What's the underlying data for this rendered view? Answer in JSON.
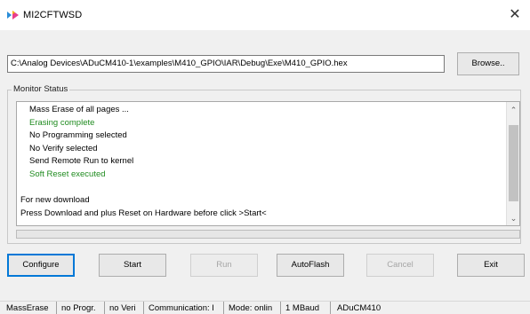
{
  "window": {
    "title": "MI2CFTWSD",
    "close_glyph": "✕",
    "icon": "app-icon"
  },
  "file": {
    "path": "C:\\Analog Devices\\ADuCM410-1\\examples\\M410_GPIO\\IAR\\Debug\\Exe\\M410_GPIO.hex",
    "browse_label": "Browse.."
  },
  "monitor": {
    "label": "Monitor Status",
    "lines": [
      {
        "text": "Mass Erase of all pages ...",
        "color": "#000000"
      },
      {
        "text": "Erasing complete",
        "color": "#1f8b1f"
      },
      {
        "text": "No Programming selected",
        "color": "#000000"
      },
      {
        "text": "No Verify selected",
        "color": "#000000"
      },
      {
        "text": "Send Remote Run to kernel",
        "color": "#000000"
      },
      {
        "text": "Soft Reset executed",
        "color": "#1f8b1f"
      },
      {
        "text": "",
        "color": "#000000"
      },
      {
        "text": "For new download",
        "color": "#000000"
      },
      {
        "text": "Press Download and plus Reset on Hardware before click >Start<",
        "color": "#000000"
      }
    ],
    "scroll_up": "⌃",
    "scroll_down": "⌄"
  },
  "progress": {
    "fraction": 0
  },
  "buttons": {
    "configure": "Configure",
    "start": "Start",
    "run": "Run",
    "autoflash": "AutoFlash",
    "cancel": "Cancel",
    "exit": "Exit"
  },
  "status": {
    "cells": [
      "MassErase",
      "no Progr.",
      "no Veri",
      "Communication: I",
      "Mode: onlin",
      "1 MBaud",
      "ADuCM410"
    ]
  },
  "colors": {
    "success": "#1f8b1f",
    "focus": "#0078d7"
  }
}
